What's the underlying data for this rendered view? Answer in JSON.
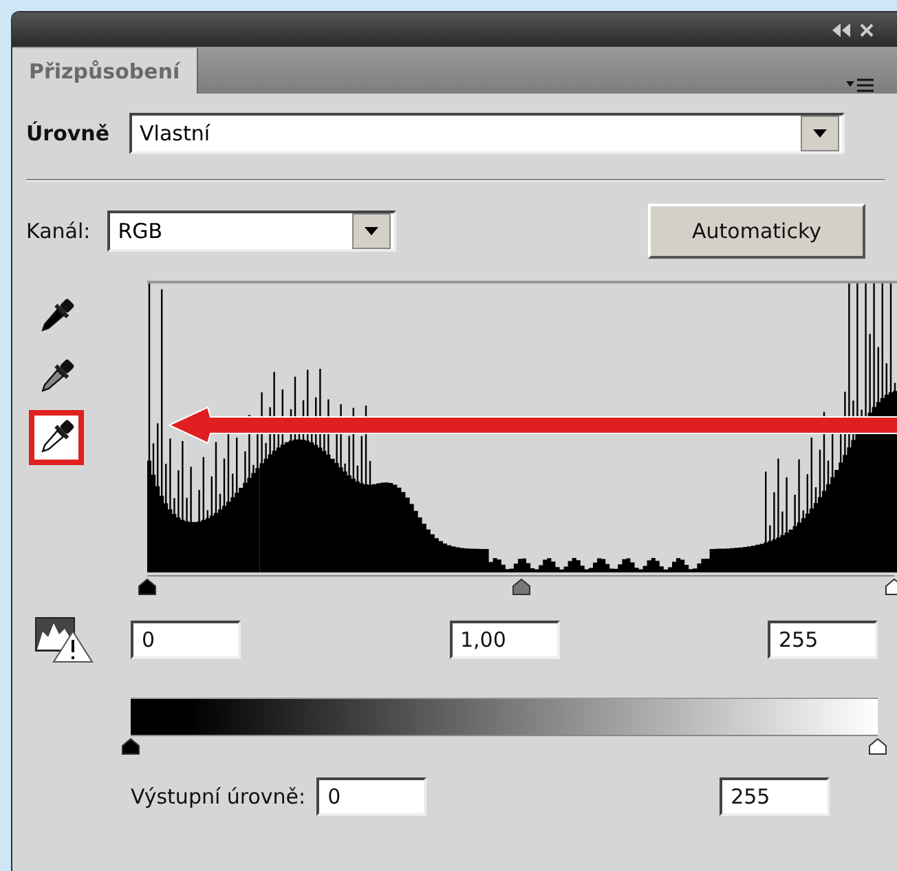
{
  "panel": {
    "tabs": [
      {
        "label": "Přizpůsobení",
        "selected": true
      }
    ]
  },
  "preset": {
    "label": "Úrovně",
    "value": "Vlastní"
  },
  "channel": {
    "label": "Kanál:",
    "value": "RGB"
  },
  "auto_button": "Automaticky",
  "eyedroppers": [
    {
      "kind": "black",
      "selected": false
    },
    {
      "kind": "gray",
      "selected": false
    },
    {
      "kind": "white",
      "selected": true
    }
  ],
  "input_levels": {
    "sliders": [
      {
        "kind": "black",
        "level": 0
      },
      {
        "kind": "gray",
        "level": 0.5
      },
      {
        "kind": "white",
        "level": 1
      }
    ],
    "values": [
      "0",
      "1,00",
      "255"
    ]
  },
  "output_levels": {
    "label": "Výstupní úrovně:",
    "sliders": [
      {
        "kind": "black",
        "level": 0
      },
      {
        "kind": "white",
        "level": 1
      }
    ],
    "values": [
      "0",
      "255"
    ]
  }
}
